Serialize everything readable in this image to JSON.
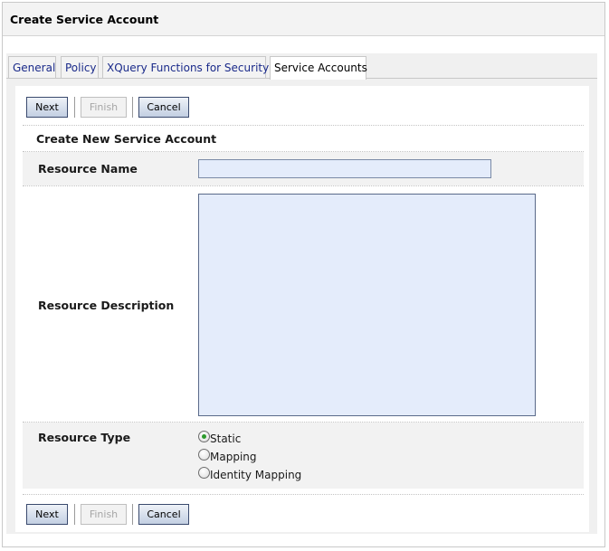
{
  "window": {
    "title": "Create Service Account"
  },
  "tabs": [
    {
      "label": "General"
    },
    {
      "label": "Policy"
    },
    {
      "label": "XQuery Functions for Security"
    },
    {
      "label": "Service Accounts"
    }
  ],
  "toolbar": {
    "next_label": "Next",
    "finish_label": "Finish",
    "cancel_label": "Cancel"
  },
  "form": {
    "section_title": "Create New Service Account",
    "resource_name": {
      "label": "Resource Name",
      "value": ""
    },
    "resource_description": {
      "label": "Resource Description",
      "value": ""
    },
    "resource_type": {
      "label": "Resource Type",
      "selected": "Static",
      "options": [
        "Static",
        "Mapping",
        "Identity Mapping"
      ]
    }
  }
}
